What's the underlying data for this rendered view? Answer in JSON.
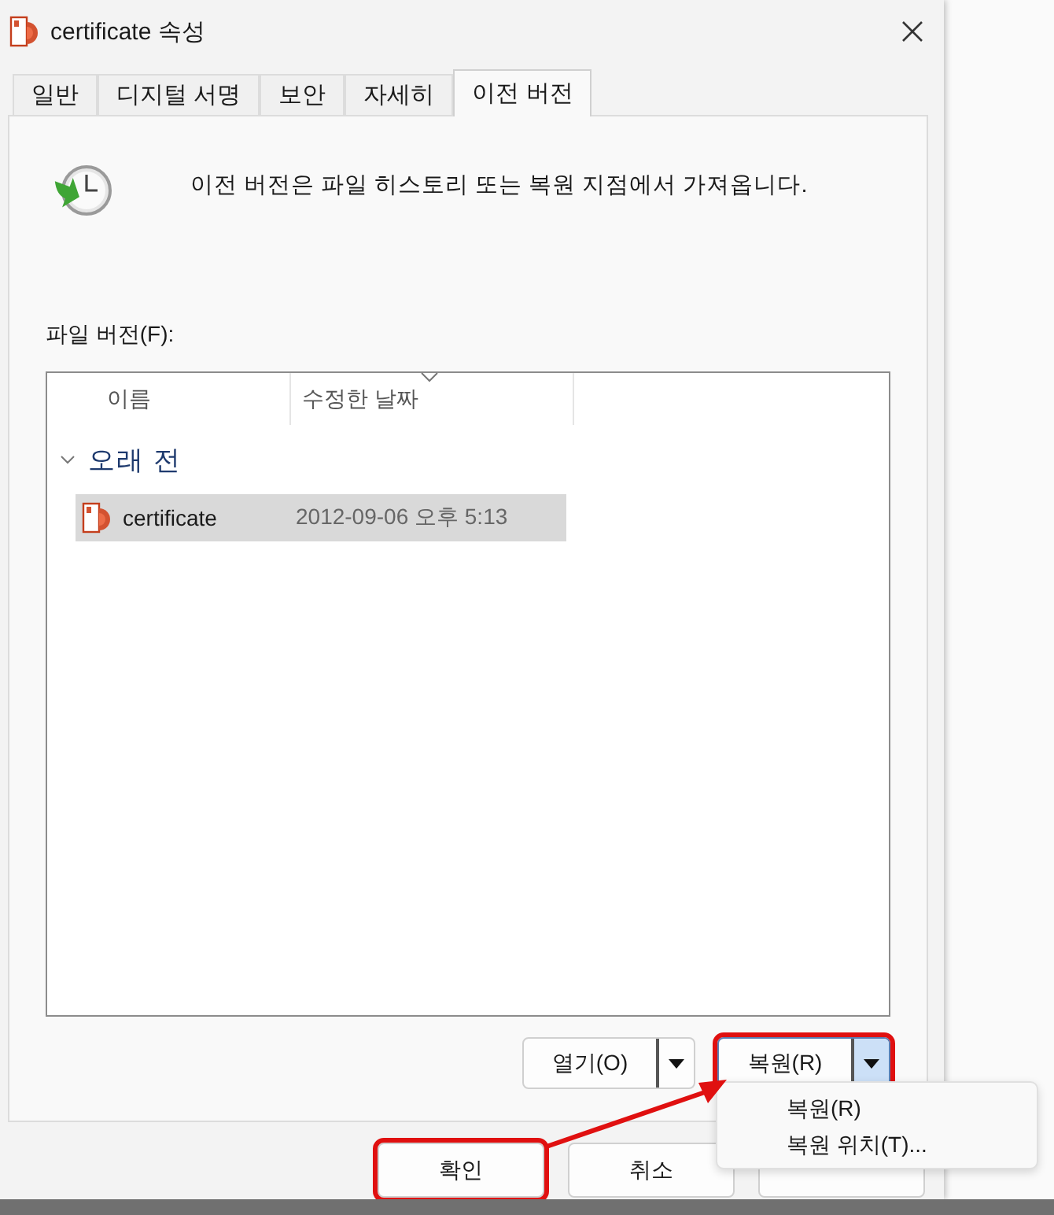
{
  "window": {
    "title": "certificate 속성"
  },
  "tabs": [
    {
      "label": "일반",
      "selected": false
    },
    {
      "label": "디지털 서명",
      "selected": false
    },
    {
      "label": "보안",
      "selected": false
    },
    {
      "label": "자세히",
      "selected": false
    },
    {
      "label": "이전 버전",
      "selected": true
    }
  ],
  "description": "이전 버전은 파일 히스토리 또는 복원 지점에서 가져옵니다.",
  "file_versions": {
    "label": "파일 버전(F):",
    "columns": [
      "이름",
      "수정한 날짜"
    ],
    "groups": [
      {
        "name": "오래 전",
        "expanded": true,
        "rows": [
          {
            "name": "certificate",
            "date": "2012-09-06 오후 5:13",
            "selected": true
          }
        ]
      }
    ]
  },
  "split_buttons": [
    {
      "label": "열기(O)",
      "highlighted": false,
      "pressed": false
    },
    {
      "label": "복원(R)",
      "highlighted": true,
      "pressed": true
    }
  ],
  "menu": {
    "items": [
      "복원(R)",
      "복원 위치(T)..."
    ]
  },
  "buttons": [
    {
      "kind": "labeled",
      "label": "확인",
      "highlighted": true
    },
    {
      "kind": "labeled",
      "label": "취소",
      "highlighted": false
    },
    {
      "kind": "covered",
      "highlighted": false
    }
  ]
}
